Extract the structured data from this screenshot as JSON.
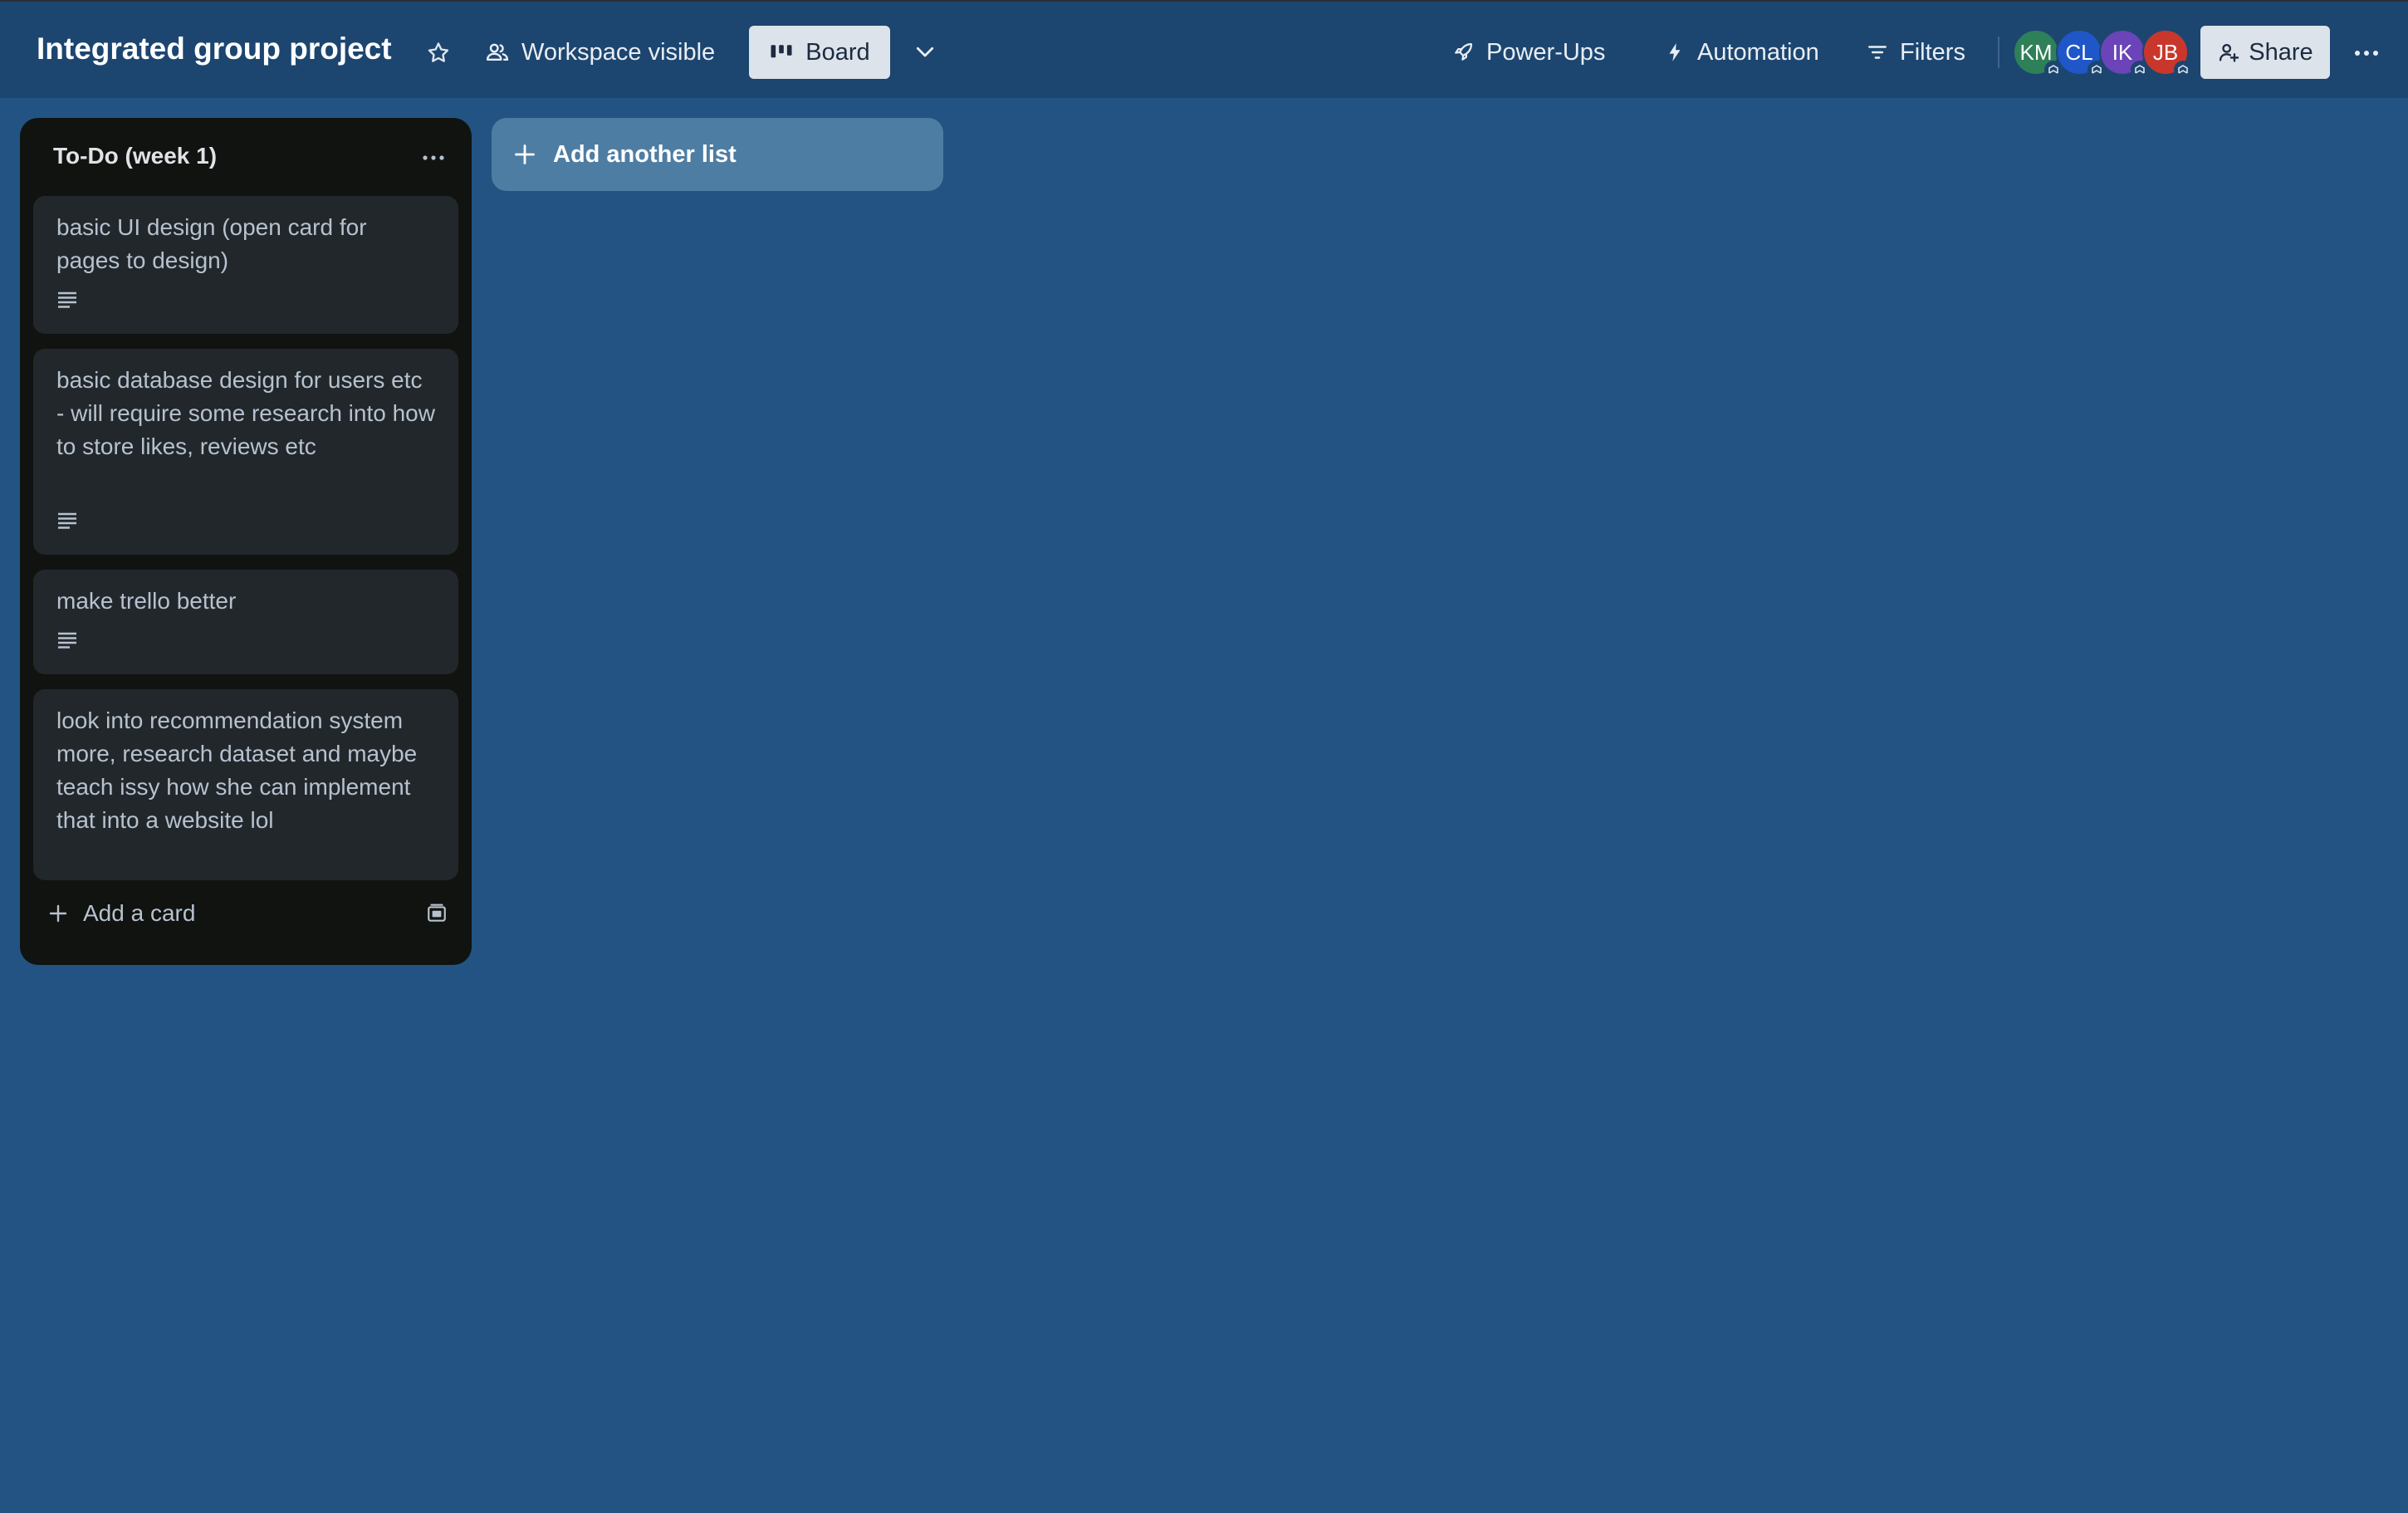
{
  "board": {
    "title": "Integrated group project",
    "visibility_label": "Workspace visible",
    "view_label": "Board"
  },
  "header": {
    "powerups_label": "Power-Ups",
    "automation_label": "Automation",
    "filters_label": "Filters",
    "share_label": "Share",
    "members": [
      {
        "initials": "KM",
        "color": "#2e8058"
      },
      {
        "initials": "CL",
        "color": "#1f56c8"
      },
      {
        "initials": "IK",
        "color": "#6a44b8"
      },
      {
        "initials": "JB",
        "color": "#c9372c"
      }
    ]
  },
  "lists": [
    {
      "title": "To-Do (week 1)",
      "cards": [
        {
          "text": "basic UI design (open card for pages to design)",
          "has_description": true
        },
        {
          "text": "basic database design for users etc - will require some research into how to store likes, reviews etc",
          "has_description": true
        },
        {
          "text": "make trello better",
          "has_description": true
        },
        {
          "text": "look into recommendation system more, research dataset and maybe teach issy how she can implement that into a website lol",
          "has_description": false
        }
      ],
      "add_card_label": "Add a card"
    }
  ],
  "add_list_label": "Add another list",
  "colors": {
    "board_background": "#225383",
    "header_background": "#1c4670",
    "list_background": "#111310",
    "card_background": "#22272b",
    "add_list_background": "#4e7da3"
  }
}
